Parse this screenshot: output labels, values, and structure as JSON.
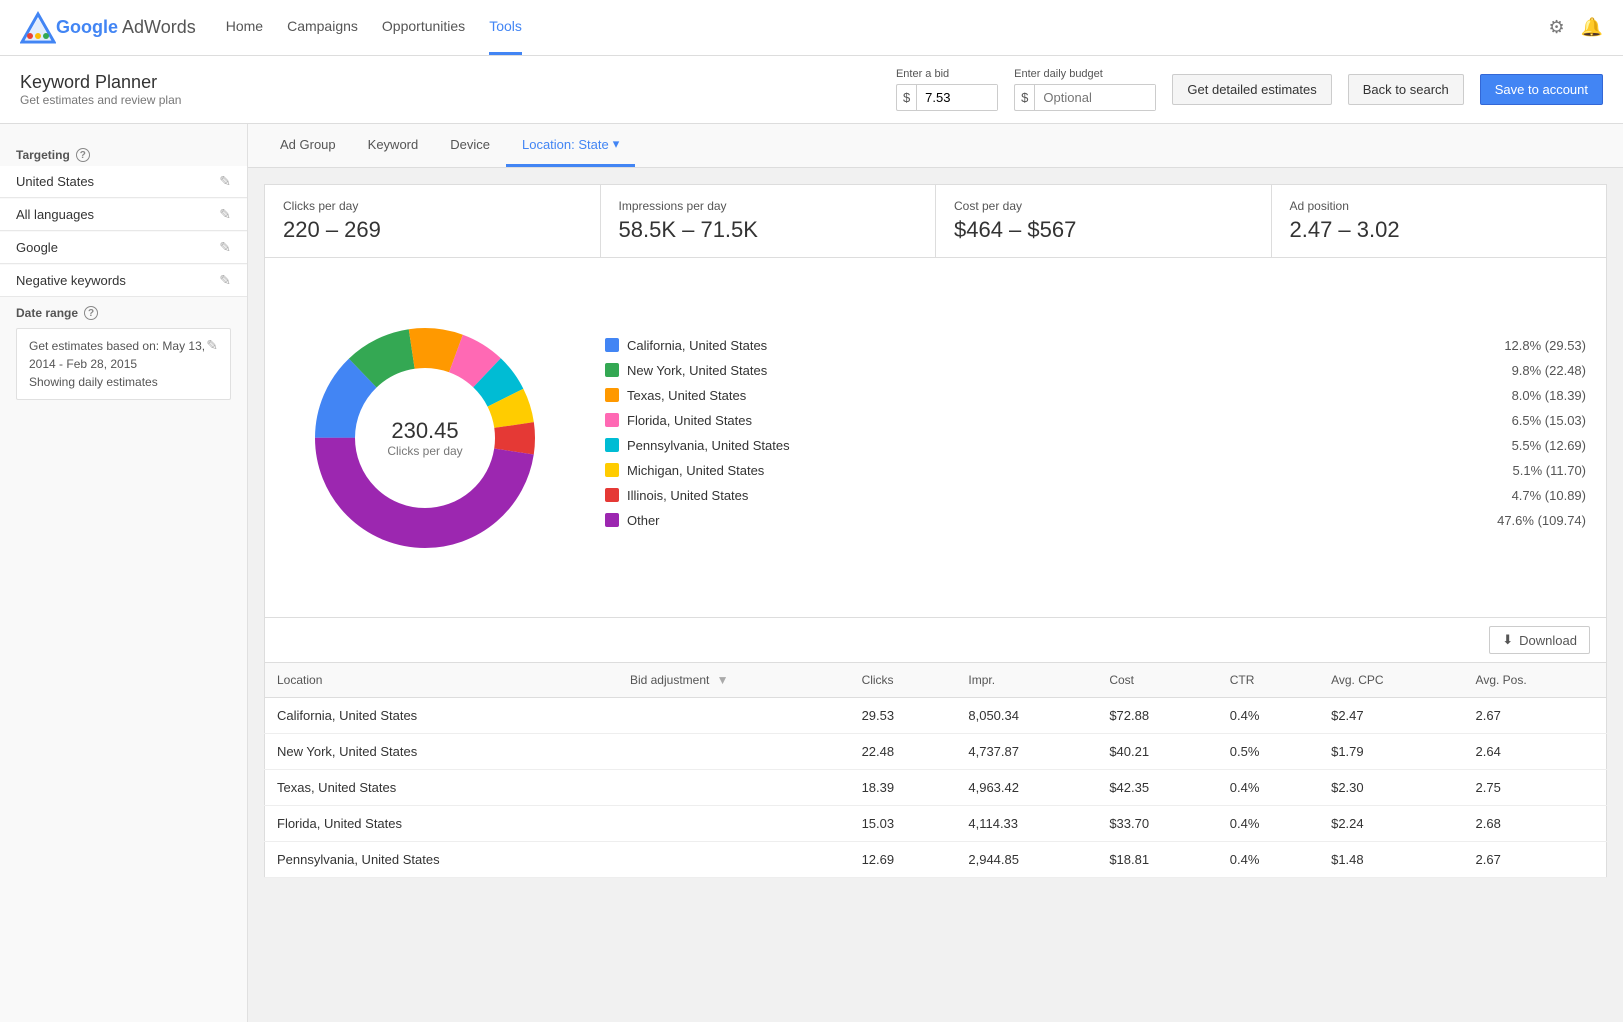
{
  "nav": {
    "brand": "Google AdWords",
    "links": [
      {
        "label": "Home",
        "active": false
      },
      {
        "label": "Campaigns",
        "active": false
      },
      {
        "label": "Opportunities",
        "active": false
      },
      {
        "label": "Tools",
        "active": true
      }
    ]
  },
  "header": {
    "title": "Keyword Planner",
    "subtitle": "Get estimates and review plan",
    "bid_label": "Enter a bid",
    "bid_value": "7.53",
    "budget_label": "Enter daily budget",
    "budget_placeholder": "Optional",
    "btn_detailed": "Get detailed estimates",
    "btn_back": "Back to search",
    "btn_save": "Save to account"
  },
  "sidebar": {
    "targeting_label": "Targeting",
    "items": [
      {
        "label": "United States"
      },
      {
        "label": "All languages"
      },
      {
        "label": "Google"
      },
      {
        "label": "Negative keywords"
      }
    ],
    "date_range_label": "Date range",
    "date_based_on": "Get estimates based on: May 13, 2014 - Feb 28, 2015",
    "date_showing": "Showing daily estimates"
  },
  "tabs": [
    {
      "label": "Ad Group",
      "active": false
    },
    {
      "label": "Keyword",
      "active": false
    },
    {
      "label": "Device",
      "active": false
    },
    {
      "label": "Location: State",
      "active": true,
      "dropdown": true
    }
  ],
  "stats": {
    "clicks_label": "Clicks per day",
    "clicks_value": "220 – 269",
    "impressions_label": "Impressions per day",
    "impressions_value": "58.5K – 71.5K",
    "cost_label": "Cost per day",
    "cost_value": "$464 – $567",
    "adpos_label": "Ad position",
    "adpos_value": "2.47 – 3.02"
  },
  "chart": {
    "center_value": "230.45",
    "center_label": "Clicks per day",
    "legend": [
      {
        "label": "California, United States",
        "value": "12.8% (29.53)",
        "color": "#4285f4"
      },
      {
        "label": "New York, United States",
        "value": "9.8% (22.48)",
        "color": "#34a853"
      },
      {
        "label": "Texas, United States",
        "value": "8.0% (18.39)",
        "color": "#ff9900"
      },
      {
        "label": "Florida, United States",
        "value": "6.5% (15.03)",
        "color": "#ff69b4"
      },
      {
        "label": "Pennsylvania, United States",
        "value": "5.5% (12.69)",
        "color": "#00bcd4"
      },
      {
        "label": "Michigan, United States",
        "value": "5.1% (11.70)",
        "color": "#ffcc00"
      },
      {
        "label": "Illinois, United States",
        "value": "4.7% (10.89)",
        "color": "#e53935"
      },
      {
        "label": "Other",
        "value": "47.6% (109.74)",
        "color": "#9c27b0"
      }
    ],
    "donut_segments": [
      {
        "color": "#4285f4",
        "pct": 12.8
      },
      {
        "color": "#34a853",
        "pct": 9.8
      },
      {
        "color": "#ff9900",
        "pct": 8.0
      },
      {
        "color": "#ff69b4",
        "pct": 6.5
      },
      {
        "color": "#00bcd4",
        "pct": 5.5
      },
      {
        "color": "#ffcc00",
        "pct": 5.1
      },
      {
        "color": "#e53935",
        "pct": 4.7
      },
      {
        "color": "#9c27b0",
        "pct": 47.6
      }
    ]
  },
  "download_btn": "Download",
  "table": {
    "columns": [
      "Location",
      "Bid adjustment",
      "Clicks",
      "Impr.",
      "Cost",
      "CTR",
      "Avg. CPC",
      "Avg. Pos."
    ],
    "rows": [
      {
        "location": "California, United States",
        "bid": "",
        "clicks": "29.53",
        "impr": "8,050.34",
        "cost": "$72.88",
        "ctr": "0.4%",
        "avg_cpc": "$2.47",
        "avg_pos": "2.67"
      },
      {
        "location": "New York, United States",
        "bid": "",
        "clicks": "22.48",
        "impr": "4,737.87",
        "cost": "$40.21",
        "ctr": "0.5%",
        "avg_cpc": "$1.79",
        "avg_pos": "2.64"
      },
      {
        "location": "Texas, United States",
        "bid": "",
        "clicks": "18.39",
        "impr": "4,963.42",
        "cost": "$42.35",
        "ctr": "0.4%",
        "avg_cpc": "$2.30",
        "avg_pos": "2.75"
      },
      {
        "location": "Florida, United States",
        "bid": "",
        "clicks": "15.03",
        "impr": "4,114.33",
        "cost": "$33.70",
        "ctr": "0.4%",
        "avg_cpc": "$2.24",
        "avg_pos": "2.68"
      },
      {
        "location": "Pennsylvania, United States",
        "bid": "",
        "clicks": "12.69",
        "impr": "2,944.85",
        "cost": "$18.81",
        "ctr": "0.4%",
        "avg_cpc": "$1.48",
        "avg_pos": "2.67"
      }
    ]
  }
}
